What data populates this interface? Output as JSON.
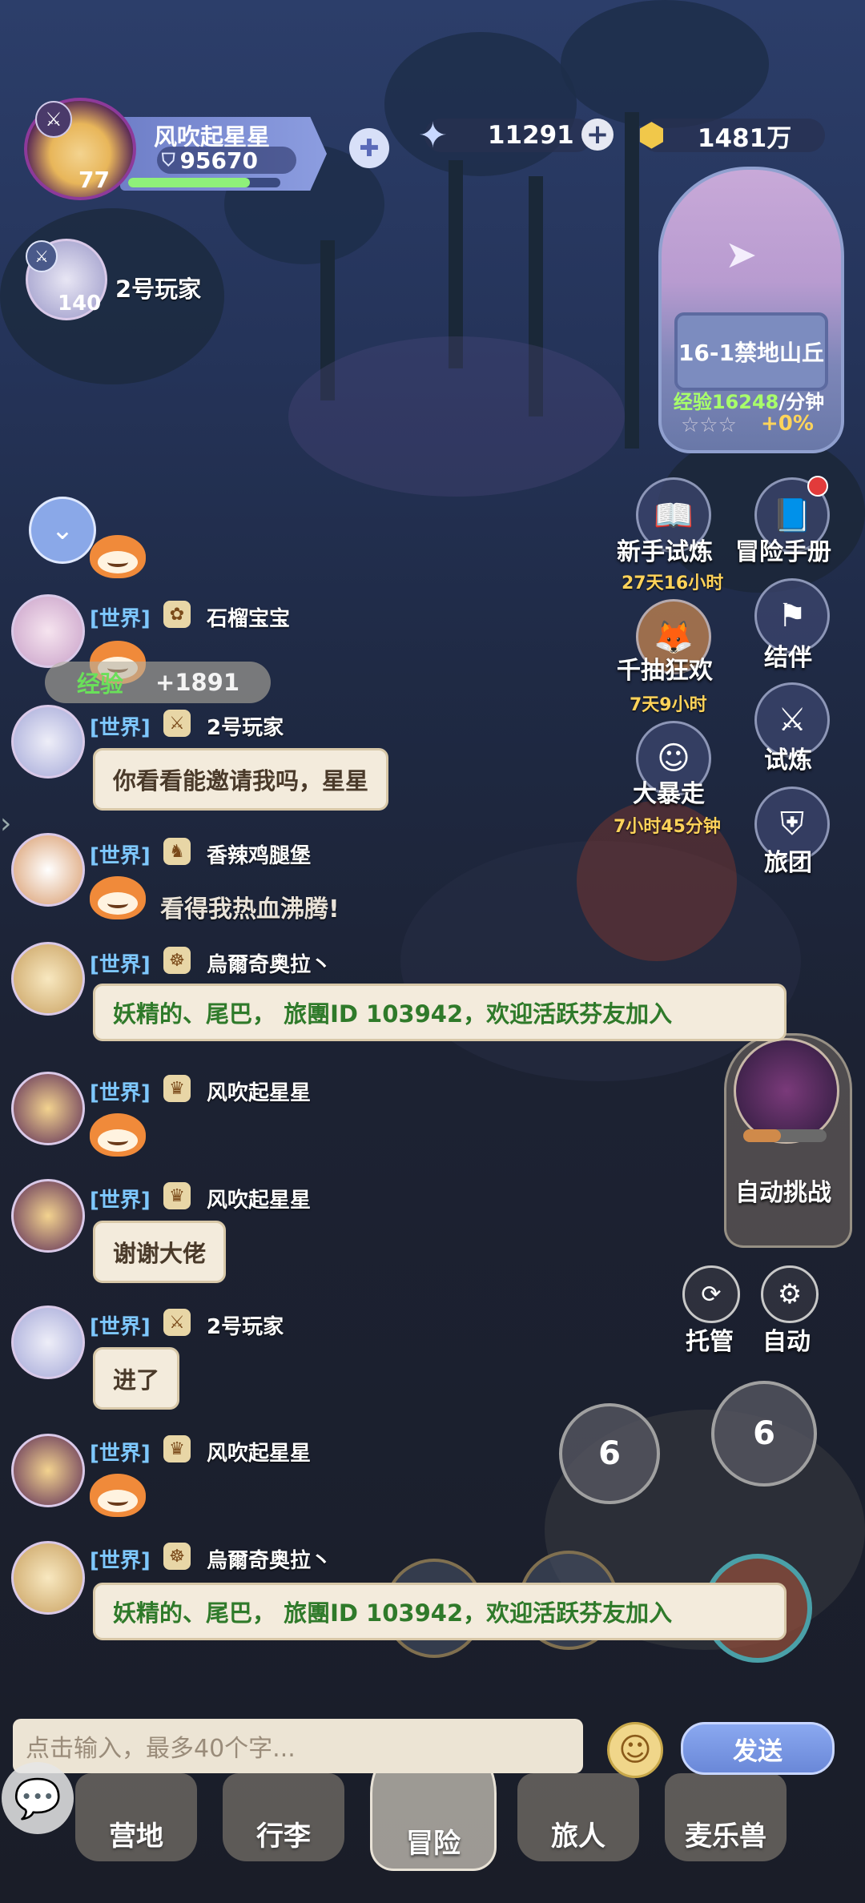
{
  "player": {
    "name": "风吹起星星",
    "power": "95670",
    "level": "77",
    "xp_fraction": 0.8
  },
  "resources": {
    "stars": "11291",
    "gold": "1481万"
  },
  "companion": {
    "name": "2号玩家",
    "level": "140"
  },
  "stage": {
    "title": "16-1禁地山丘",
    "exp_label": "经验",
    "exp_value": "16248",
    "exp_unit": "/分钟",
    "bonus": "+0%",
    "stars_filled": 0,
    "stars_total": 3
  },
  "features": [
    {
      "label": "新手试炼",
      "timer": "27天16小时"
    },
    {
      "label": "冒险手册",
      "timer": ""
    },
    {
      "label": "千抽狂欢",
      "timer": "7天9小时"
    },
    {
      "label": "结伴",
      "timer": ""
    },
    {
      "label": "大暴走",
      "timer": "7小时45分钟"
    },
    {
      "label": "试炼",
      "timer": ""
    },
    {
      "label": "旅团",
      "timer": ""
    }
  ],
  "auto_challenge": {
    "label": "自动挑战"
  },
  "controls": {
    "managed": "托管",
    "auto": "自动"
  },
  "skills": {
    "skill1": "6",
    "skill2": "6"
  },
  "exp_toast": {
    "label": "经验",
    "value": "+1891"
  },
  "chat": {
    "channel": "[世界]",
    "messages": [
      {
        "name": "石榴宝宝",
        "text": ""
      },
      {
        "name": "2号玩家",
        "text": "你看看能邀请我吗，星星"
      },
      {
        "name": "香辣鸡腿堡",
        "text": "看得我热血沸腾!"
      },
      {
        "name": "烏爾奇奥拉丶",
        "text": "妖精的、尾巴，   旅團ID 103942，欢迎活跃芬友加入"
      },
      {
        "name": "风吹起星星",
        "text": ""
      },
      {
        "name": "风吹起星星",
        "text": "谢谢大佬"
      },
      {
        "name": "2号玩家",
        "text": "进了"
      },
      {
        "name": "风吹起星星",
        "text": ""
      },
      {
        "name": "烏爾奇奥拉丶",
        "text": "妖精的、尾巴，   旅團ID 103942，欢迎活跃芬友加入"
      }
    ],
    "input_placeholder": "点击输入，最多40个字...",
    "send_label": "发送"
  },
  "nav": [
    "营地",
    "行李",
    "冒险",
    "旅人",
    "麦乐兽"
  ]
}
